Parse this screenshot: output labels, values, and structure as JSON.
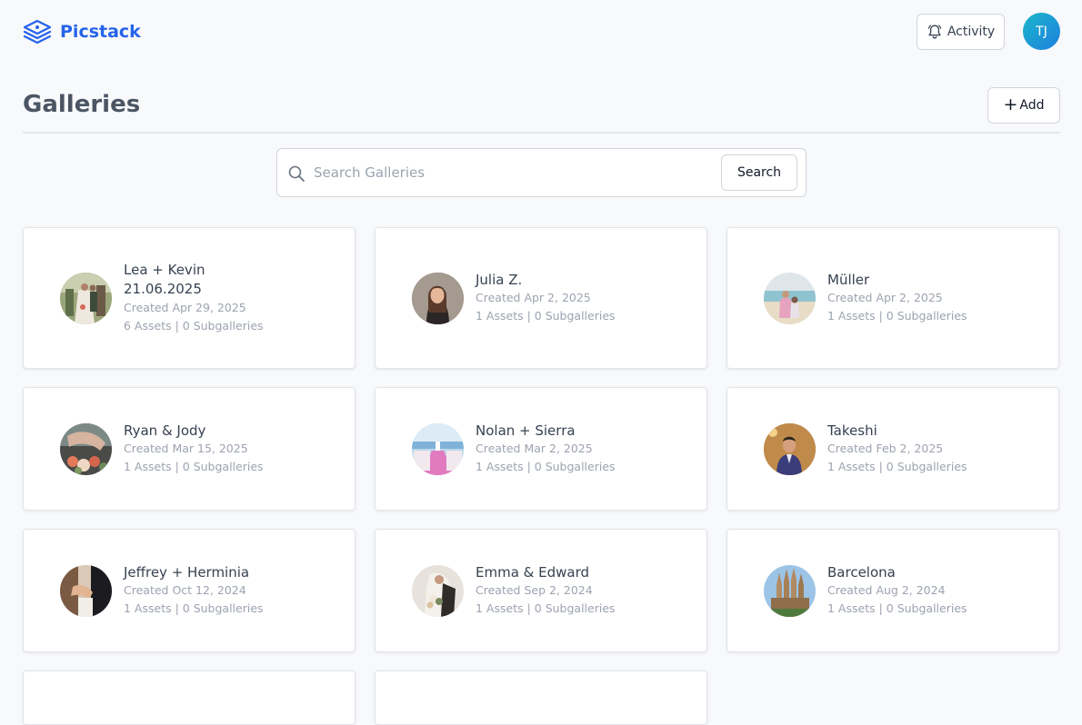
{
  "header": {
    "brand": "Picstack",
    "activity_label": "Activity",
    "user_initials": "TJ",
    "brand_color": "#2563eb"
  },
  "page": {
    "title": "Galleries",
    "add_label": "Add"
  },
  "search": {
    "placeholder": "Search Galleries",
    "value": "",
    "button_label": "Search"
  },
  "galleries": [
    {
      "name": "Lea + Kevin",
      "subtitle": "21.06.2025",
      "created": "Created Apr 29, 2025",
      "counts": "6 Assets | 0 Subgalleries"
    },
    {
      "name": "Julia Z.",
      "created": "Created Apr 2, 2025",
      "counts": "1 Assets | 0 Subgalleries"
    },
    {
      "name": "Müller",
      "created": "Created Apr 2, 2025",
      "counts": "1 Assets | 0 Subgalleries"
    },
    {
      "name": "Ryan & Jody",
      "created": "Created Mar 15, 2025",
      "counts": "1 Assets | 0 Subgalleries"
    },
    {
      "name": "Nolan + Sierra",
      "created": "Created Mar 2, 2025",
      "counts": "1 Assets | 0 Subgalleries"
    },
    {
      "name": "Takeshi",
      "created": "Created Feb 2, 2025",
      "counts": "1 Assets | 0 Subgalleries"
    },
    {
      "name": "Jeffrey + Herminia",
      "created": "Created Oct 12, 2024",
      "counts": "1 Assets | 0 Subgalleries"
    },
    {
      "name": "Emma & Edward",
      "created": "Created Sep 2, 2024",
      "counts": "1 Assets | 0 Subgalleries"
    },
    {
      "name": "Barcelona",
      "created": "Created Aug 2, 2024",
      "counts": "1 Assets | 0 Subgalleries"
    }
  ]
}
